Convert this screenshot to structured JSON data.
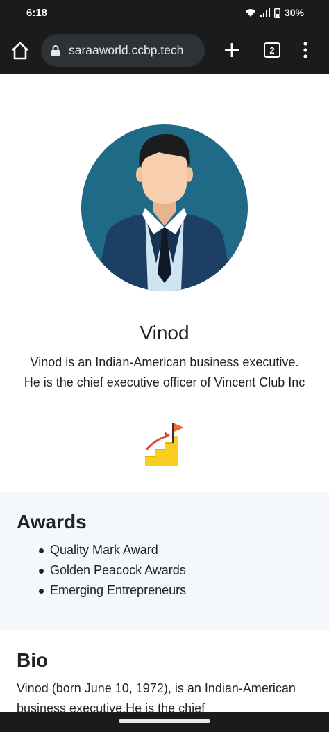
{
  "status_bar": {
    "time": "6:18",
    "battery": "30%",
    "icons": [
      "wifi-icon",
      "signal-icon",
      "battery-icon"
    ]
  },
  "browser": {
    "url": "saraaworld.ccbp.tech",
    "tab_count": "2",
    "icons": [
      "home-icon",
      "lock-icon",
      "plus-icon",
      "tabs-icon",
      "more-vert-icon"
    ]
  },
  "profile": {
    "name": "Vinod",
    "description": "Vinod is an Indian-American business executive. He is the chief executive officer of Vincent Club Inc",
    "avatar": "businessman-avatar",
    "badge_icon": "growth-stairs-flag-icon"
  },
  "awards": {
    "title": "Awards",
    "items": [
      "Quality Mark Award",
      "Golden Peacock Awards",
      "Emerging Entrepreneurs"
    ]
  },
  "bio": {
    "title": "Bio",
    "text": "Vinod (born June 10, 1972), is an Indian-American business executive.He is the chief"
  },
  "colors": {
    "browser_chrome": "#1b1b1b",
    "url_pill": "#2d3236",
    "avatar_bg": "#1f6a87",
    "suit": "#1d3f63",
    "awards_bg": "#f4f8fc"
  }
}
